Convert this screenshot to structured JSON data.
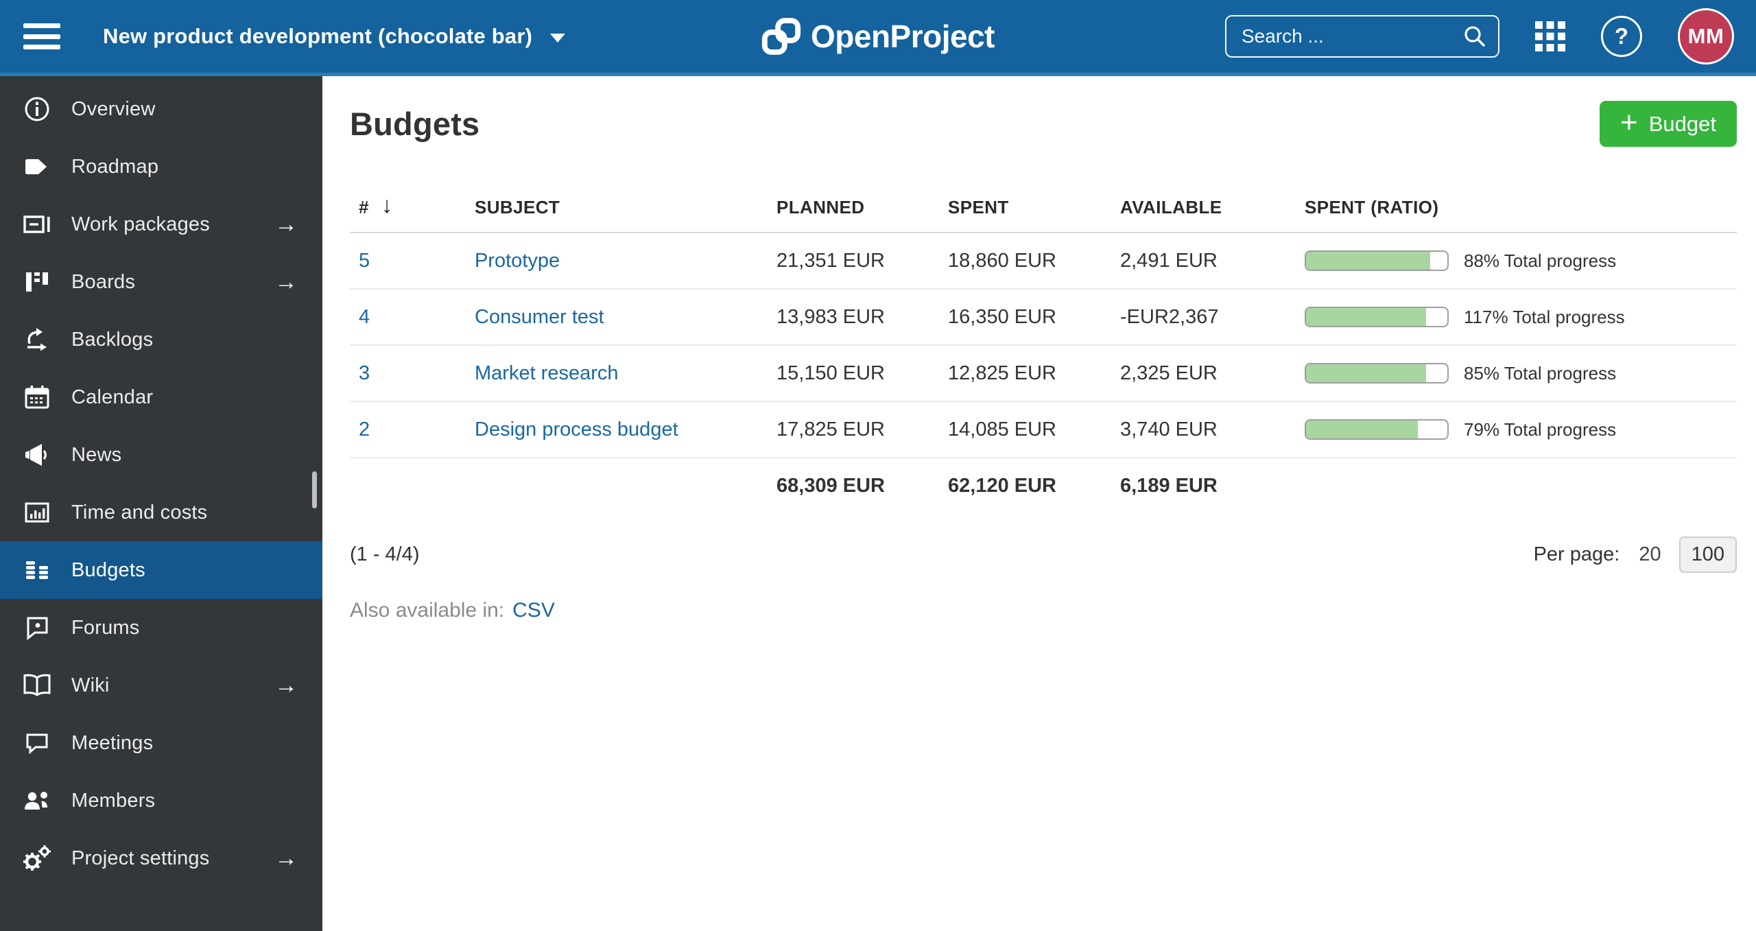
{
  "topbar": {
    "project_selector": "New product development (chocolate bar)",
    "logo_text": "OpenProject",
    "search_placeholder": "Search ...",
    "avatar_initials": "MM"
  },
  "sidebar": {
    "items": [
      {
        "label": "Overview",
        "icon": "info",
        "has_arrow": false,
        "active": false
      },
      {
        "label": "Roadmap",
        "icon": "roadmap",
        "has_arrow": false,
        "active": false
      },
      {
        "label": "Work packages",
        "icon": "work-packages",
        "has_arrow": true,
        "active": false
      },
      {
        "label": "Boards",
        "icon": "boards",
        "has_arrow": true,
        "active": false
      },
      {
        "label": "Backlogs",
        "icon": "backlogs",
        "has_arrow": false,
        "active": false
      },
      {
        "label": "Calendar",
        "icon": "calendar",
        "has_arrow": false,
        "active": false
      },
      {
        "label": "News",
        "icon": "news",
        "has_arrow": false,
        "active": false
      },
      {
        "label": "Time and costs",
        "icon": "time-costs",
        "has_arrow": false,
        "active": false
      },
      {
        "label": "Budgets",
        "icon": "budgets",
        "has_arrow": false,
        "active": true
      },
      {
        "label": "Forums",
        "icon": "forums",
        "has_arrow": false,
        "active": false
      },
      {
        "label": "Wiki",
        "icon": "wiki",
        "has_arrow": true,
        "active": false
      },
      {
        "label": "Meetings",
        "icon": "meetings",
        "has_arrow": false,
        "active": false
      },
      {
        "label": "Members",
        "icon": "members",
        "has_arrow": false,
        "active": false
      },
      {
        "label": "Project settings",
        "icon": "settings",
        "has_arrow": true,
        "active": false
      }
    ]
  },
  "main": {
    "title": "Budgets",
    "add_button_label": "Budget",
    "table": {
      "columns": [
        "#",
        "SUBJECT",
        "PLANNED",
        "SPENT",
        "AVAILABLE",
        "SPENT (RATIO)"
      ],
      "sorted_column": "#",
      "sort_direction": "desc",
      "rows": [
        {
          "id": "5",
          "subject": "Prototype",
          "planned": "21,351 EUR",
          "spent": "18,860 EUR",
          "available": "2,491 EUR",
          "ratio_percent": 88,
          "ratio_label": "88% Total progress"
        },
        {
          "id": "4",
          "subject": "Consumer test",
          "planned": "13,983 EUR",
          "spent": "16,350 EUR",
          "available": "-EUR2,367",
          "ratio_percent": 117,
          "ratio_label": "117% Total progress"
        },
        {
          "id": "3",
          "subject": "Market research",
          "planned": "15,150 EUR",
          "spent": "12,825 EUR",
          "available": "2,325 EUR",
          "ratio_percent": 85,
          "ratio_label": "85% Total progress"
        },
        {
          "id": "2",
          "subject": "Design process budget",
          "planned": "17,825 EUR",
          "spent": "14,085 EUR",
          "available": "3,740 EUR",
          "ratio_percent": 79,
          "ratio_label": "79% Total progress"
        }
      ],
      "totals": {
        "planned": "68,309 EUR",
        "spent": "62,120 EUR",
        "available": "6,189 EUR"
      }
    },
    "pagination": {
      "range_label": "(1 - 4/4)",
      "per_page_label": "Per page:",
      "options": [
        {
          "value": "20",
          "selected": false
        },
        {
          "value": "100",
          "selected": true
        }
      ]
    },
    "export": {
      "prefix": "Also available in:",
      "format": "CSV"
    }
  },
  "colors": {
    "header_blue": "#14629E",
    "accent_line": "#2E7CB7",
    "sidebar_bg": "#333739",
    "active_item_blue": "#14578C",
    "button_green": "#35B53C",
    "link_blue": "#1A67A3",
    "progress_fill": "#A9D5A1",
    "avatar_bg": "#BF3A54"
  }
}
